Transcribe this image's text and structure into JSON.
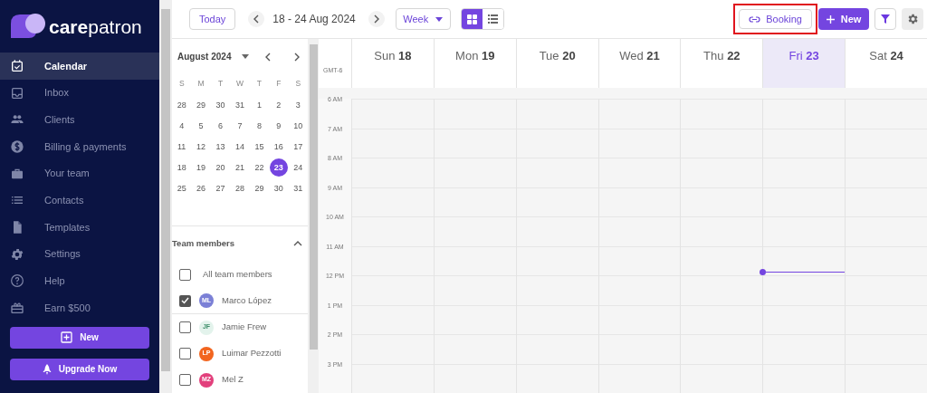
{
  "brand": {
    "bold": "care",
    "light": "patron"
  },
  "nav": [
    {
      "label": "Calendar",
      "selected": true
    },
    {
      "label": "Inbox",
      "selected": false
    },
    {
      "label": "Clients",
      "selected": false
    },
    {
      "label": "Billing & payments",
      "selected": false
    },
    {
      "label": "Your team",
      "selected": false
    },
    {
      "label": "Contacts",
      "selected": false
    },
    {
      "label": "Templates",
      "selected": false
    },
    {
      "label": "Settings",
      "selected": false
    },
    {
      "label": "Help",
      "selected": false
    },
    {
      "label": "Earn $500",
      "selected": false
    }
  ],
  "sidebar_buttons": [
    "New",
    "Upgrade Now"
  ],
  "toolbar": {
    "today": "Today",
    "range": "18 - 24 Aug 2024",
    "view": "Week",
    "view_modes": [
      {
        "selected": true
      },
      {
        "selected": false
      }
    ],
    "booking": "Booking",
    "new": "New"
  },
  "mini_calendar": {
    "month": "August 2024",
    "weekdays": [
      "S",
      "M",
      "T",
      "W",
      "T",
      "F",
      "S"
    ],
    "weeks": [
      [
        {
          "day": "28",
          "selected": false
        },
        {
          "day": "29",
          "selected": false
        },
        {
          "day": "30",
          "selected": false
        },
        {
          "day": "31",
          "selected": false
        },
        {
          "day": "1",
          "selected": false
        },
        {
          "day": "2",
          "selected": false
        },
        {
          "day": "3",
          "selected": false
        }
      ],
      [
        {
          "day": "4",
          "selected": false
        },
        {
          "day": "5",
          "selected": false
        },
        {
          "day": "6",
          "selected": false
        },
        {
          "day": "7",
          "selected": false
        },
        {
          "day": "8",
          "selected": false
        },
        {
          "day": "9",
          "selected": false
        },
        {
          "day": "10",
          "selected": false
        }
      ],
      [
        {
          "day": "11",
          "selected": false
        },
        {
          "day": "12",
          "selected": false
        },
        {
          "day": "13",
          "selected": false
        },
        {
          "day": "14",
          "selected": false
        },
        {
          "day": "15",
          "selected": false
        },
        {
          "day": "16",
          "selected": false
        },
        {
          "day": "17",
          "selected": false
        }
      ],
      [
        {
          "day": "18",
          "selected": false
        },
        {
          "day": "19",
          "selected": false
        },
        {
          "day": "20",
          "selected": false
        },
        {
          "day": "21",
          "selected": false
        },
        {
          "day": "22",
          "selected": false
        },
        {
          "day": "23",
          "selected": true
        },
        {
          "day": "24",
          "selected": false
        }
      ],
      [
        {
          "day": "25",
          "selected": false
        },
        {
          "day": "26",
          "selected": false
        },
        {
          "day": "27",
          "selected": false
        },
        {
          "day": "28",
          "selected": false
        },
        {
          "day": "29",
          "selected": false
        },
        {
          "day": "30",
          "selected": false
        },
        {
          "day": "31",
          "selected": false
        }
      ]
    ]
  },
  "team": {
    "title": "Team members",
    "all": {
      "label": "All team members",
      "checked": false
    },
    "members": [
      {
        "initials": "ML",
        "name": "Marco López",
        "checked": true,
        "color": "#7b80d6"
      },
      {
        "initials": "JF",
        "name": "Jamie Frew",
        "checked": false,
        "color": "#e3f3ec"
      },
      {
        "initials": "LP",
        "name": "Luimar Pezzotti",
        "checked": false,
        "color": "#f2651f"
      },
      {
        "initials": "MZ",
        "name": "Mel Z",
        "checked": false,
        "color": "#e2407c"
      }
    ]
  },
  "calendar": {
    "timezone": "GMT-6",
    "days": [
      {
        "name": "Sun",
        "date": "18",
        "selected": false
      },
      {
        "name": "Mon",
        "date": "19",
        "selected": false
      },
      {
        "name": "Tue",
        "date": "20",
        "selected": false
      },
      {
        "name": "Wed",
        "date": "21",
        "selected": false
      },
      {
        "name": "Thu",
        "date": "22",
        "selected": false
      },
      {
        "name": "Fri",
        "date": "23",
        "selected": true
      },
      {
        "name": "Sat",
        "date": "24",
        "selected": false
      }
    ],
    "hours": [
      {
        "label": "6 AM",
        "now": false
      },
      {
        "label": "7 AM",
        "now": false
      },
      {
        "label": "8 AM",
        "now": false
      },
      {
        "label": "9 AM",
        "now": false
      },
      {
        "label": "10 AM",
        "now": false
      },
      {
        "label": "11 AM",
        "now": true
      },
      {
        "label": "12 PM",
        "now": false
      },
      {
        "label": "1 PM",
        "now": false
      },
      {
        "label": "2 PM",
        "now": false
      },
      {
        "label": "3 PM",
        "now": false
      }
    ]
  }
}
